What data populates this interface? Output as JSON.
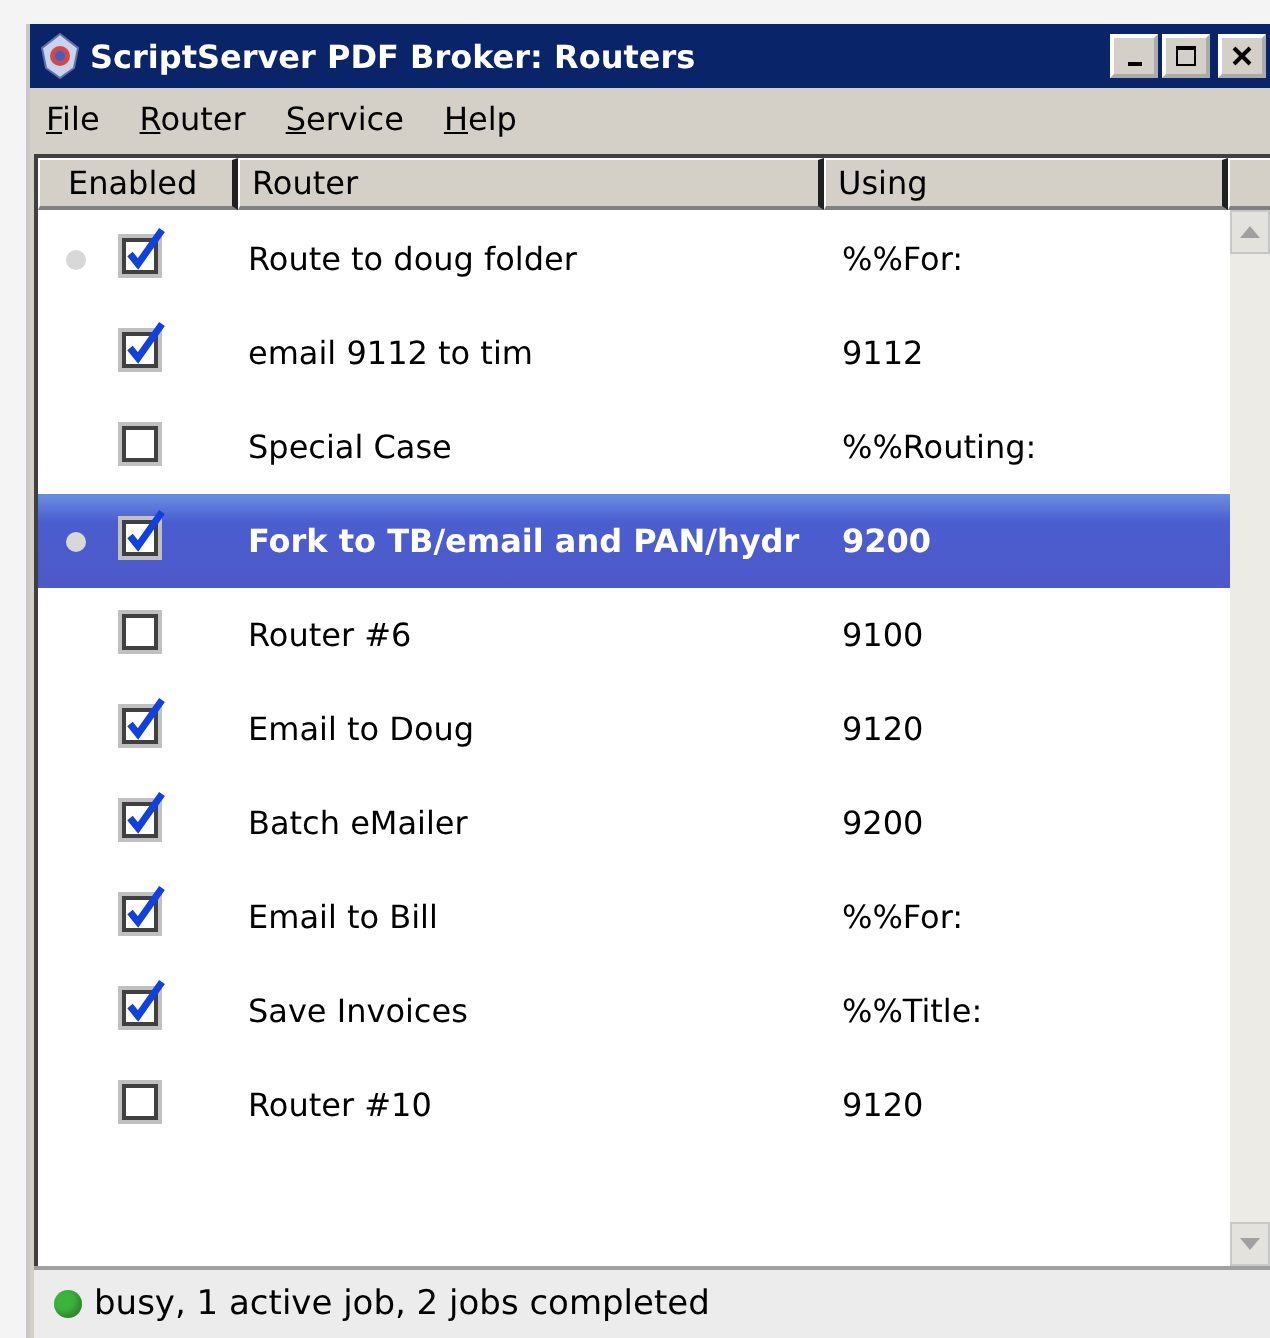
{
  "window": {
    "title": "ScriptServer PDF Broker: Routers"
  },
  "menu": [
    "File",
    "Router",
    "Service",
    "Help"
  ],
  "table": {
    "columns": [
      "Enabled",
      "Router",
      "Using"
    ],
    "rows": [
      {
        "router": "Route to doug folder",
        "using": "%%For:",
        "enabled": true,
        "active": true,
        "selected": false
      },
      {
        "router": "email 9112 to tim",
        "using": "9112",
        "enabled": true,
        "active": false,
        "selected": false
      },
      {
        "router": "Special Case",
        "using": "%%Routing:",
        "enabled": false,
        "active": false,
        "selected": false
      },
      {
        "router": "Fork to TB/email and PAN/hydr",
        "using": "9200",
        "enabled": true,
        "active": true,
        "selected": true
      },
      {
        "router": "Router #6",
        "using": "9100",
        "enabled": false,
        "active": false,
        "selected": false
      },
      {
        "router": "Email to Doug",
        "using": "9120",
        "enabled": true,
        "active": false,
        "selected": false
      },
      {
        "router": "Batch eMailer",
        "using": "9200",
        "enabled": true,
        "active": false,
        "selected": false
      },
      {
        "router": "Email to Bill",
        "using": "%%For:",
        "enabled": true,
        "active": false,
        "selected": false
      },
      {
        "router": "Save Invoices",
        "using": "%%Title:",
        "enabled": true,
        "active": false,
        "selected": false
      },
      {
        "router": "Router #10",
        "using": "9120",
        "enabled": false,
        "active": false,
        "selected": false
      }
    ]
  },
  "status_bar": {
    "text": "busy, 1 active job, 2 jobs completed",
    "color": "#3cb43c"
  }
}
